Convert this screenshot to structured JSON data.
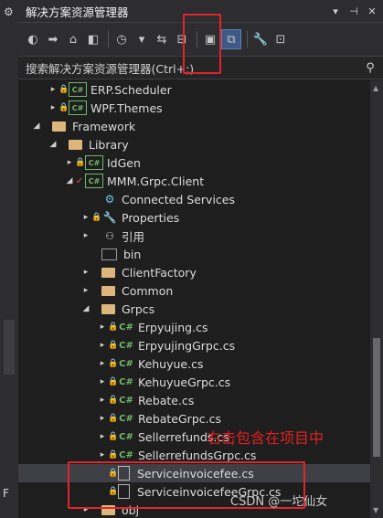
{
  "left_strip": {
    "gear_glyph": "⚙",
    "letter": "F"
  },
  "titlebar": {
    "title": "解决方案资源管理器",
    "buttons": [
      "▾",
      "⊣",
      "✕"
    ]
  },
  "toolbar": {
    "buttons": [
      {
        "name": "back-icon",
        "glyph": "◐"
      },
      {
        "name": "forward-icon",
        "glyph": "➡"
      },
      {
        "name": "home-icon",
        "glyph": "⌂"
      },
      {
        "name": "switch-views-icon",
        "glyph": "◧"
      },
      {
        "name": "pending-changes-icon",
        "glyph": "◷"
      },
      {
        "name": "dropdown-icon",
        "glyph": "▾"
      },
      {
        "name": "sync-icon",
        "glyph": "⇆"
      },
      {
        "name": "collapse-icon",
        "glyph": "⊟"
      },
      {
        "name": "show-all-files-icon",
        "glyph": "▣"
      },
      {
        "name": "copy-icon",
        "glyph": "⧉"
      },
      {
        "name": "properties-wrench-icon",
        "glyph": "🔧"
      },
      {
        "name": "preview-icon",
        "glyph": "⊡"
      }
    ]
  },
  "search": {
    "placeholder": "搜索解决方案资源管理器(Ctrl+;)",
    "icon": "⚲",
    "dropdown": "▾"
  },
  "tree": [
    {
      "indent": 2,
      "arrow": "▸",
      "lock": true,
      "icon": "proj",
      "label": "ERP.Scheduler"
    },
    {
      "indent": 2,
      "arrow": "▸",
      "lock": true,
      "icon": "proj",
      "label": "WPF.Themes"
    },
    {
      "indent": 1,
      "arrow": "◢",
      "lock": false,
      "icon": "folder",
      "label": "Framework"
    },
    {
      "indent": 2,
      "arrow": "◢",
      "lock": false,
      "icon": "folder",
      "label": "Library"
    },
    {
      "indent": 3,
      "arrow": "▸",
      "lock": true,
      "icon": "proj",
      "label": "IdGen"
    },
    {
      "indent": 3,
      "arrow": "◢",
      "check": true,
      "icon": "proj",
      "label": "MMM.Grpc.Client"
    },
    {
      "indent": 4,
      "arrow": "",
      "lock": false,
      "icon": "svc",
      "label": "Connected Services"
    },
    {
      "indent": 4,
      "arrow": "▸",
      "lock": true,
      "icon": "wrench",
      "label": "Properties"
    },
    {
      "indent": 4,
      "arrow": "▸",
      "lock": false,
      "icon": "ref",
      "label": "引用"
    },
    {
      "indent": 4,
      "arrow": "",
      "lock": false,
      "icon": "folder-outline",
      "label": "bin"
    },
    {
      "indent": 4,
      "arrow": "▸",
      "lock": false,
      "icon": "folder",
      "label": "ClientFactory"
    },
    {
      "indent": 4,
      "arrow": "▸",
      "lock": false,
      "icon": "folder",
      "label": "Common"
    },
    {
      "indent": 4,
      "arrow": "◢",
      "lock": false,
      "icon": "folder",
      "label": "Grpcs"
    },
    {
      "indent": 5,
      "arrow": "▸",
      "lock": true,
      "icon": "cs",
      "label": "Erpyujing.cs"
    },
    {
      "indent": 5,
      "arrow": "▸",
      "lock": true,
      "icon": "cs",
      "label": "ErpyujingGrpc.cs"
    },
    {
      "indent": 5,
      "arrow": "▸",
      "lock": true,
      "icon": "cs",
      "label": "Kehuyue.cs"
    },
    {
      "indent": 5,
      "arrow": "▸",
      "lock": true,
      "icon": "cs",
      "label": "KehuyueGrpc.cs"
    },
    {
      "indent": 5,
      "arrow": "▸",
      "lock": true,
      "icon": "cs",
      "label": "Rebate.cs"
    },
    {
      "indent": 5,
      "arrow": "▸",
      "lock": true,
      "icon": "cs",
      "label": "RebateGrpc.cs"
    },
    {
      "indent": 5,
      "arrow": "▸",
      "lock": true,
      "icon": "cs",
      "label": "Sellerrefunds.cs"
    },
    {
      "indent": 5,
      "arrow": "▸",
      "lock": true,
      "icon": "cs",
      "label": "SellerrefundsGrpc.cs"
    },
    {
      "indent": 5,
      "arrow": "",
      "lock": true,
      "icon": "file",
      "label": "Serviceinvoicefee.cs",
      "selected": true
    },
    {
      "indent": 5,
      "arrow": "",
      "lock": true,
      "icon": "file",
      "label": "ServiceinvoicefeeGrpc.cs"
    },
    {
      "indent": 4,
      "arrow": "▸",
      "lock": false,
      "icon": "folder",
      "label": "obj"
    }
  ],
  "annotation": "右击包含在项目中",
  "watermark": "CSDN @一坨仙女",
  "colors": {
    "highlight_red": "#e0242c",
    "background": "#1e1e1e",
    "proj_green": "#6fb86a",
    "folder_yellow": "#dcb67a"
  }
}
